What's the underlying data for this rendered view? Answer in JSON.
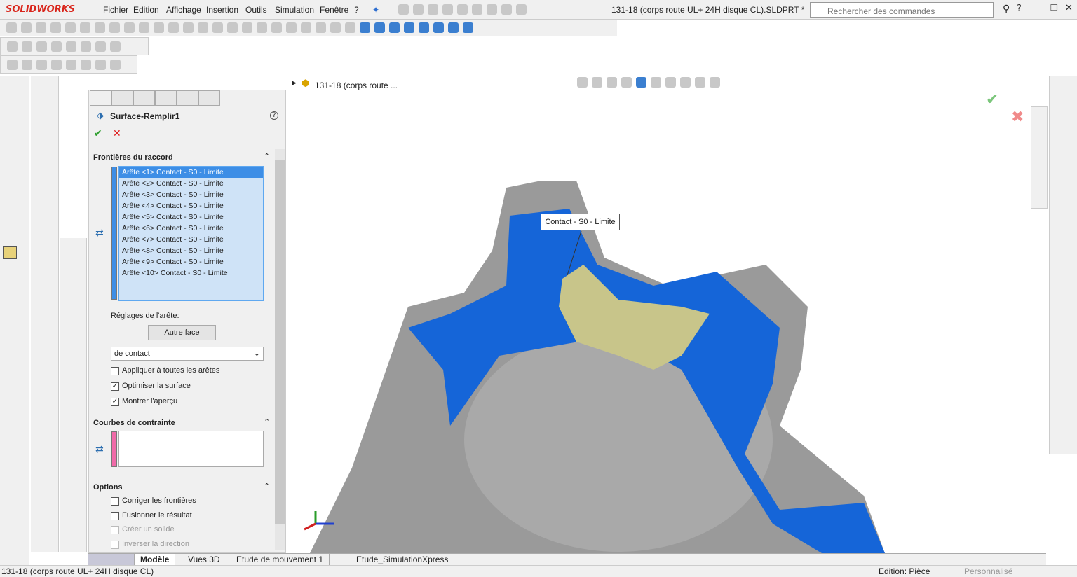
{
  "app": {
    "logo": "SOLIDWORKS",
    "title": "131-18 (corps route UL+ 24H disque CL).SLDPRT *"
  },
  "menu": [
    "Fichier",
    "Edition",
    "Affichage",
    "Insertion",
    "Outils",
    "Simulation",
    "Fenêtre",
    "?"
  ],
  "search": {
    "placeholder": "Rechercher des commandes"
  },
  "viewport": {
    "tree_label": "131-18 (corps route ...",
    "callout": "Contact - S0 - Limite"
  },
  "panel": {
    "feature": "Surface-Remplir1",
    "sections": {
      "boundaries": "Frontières du raccord",
      "constraints": "Courbes de contrainte",
      "options": "Options"
    },
    "edges": [
      "Arête <1> Contact - S0 - Limite",
      "Arête <2> Contact - S0 - Limite",
      "Arête <3> Contact - S0 - Limite",
      "Arête <4> Contact - S0 - Limite",
      "Arête <5> Contact - S0 - Limite",
      "Arête <6> Contact - S0 - Limite",
      "Arête <7> Contact - S0 - Limite",
      "Arête <8> Contact - S0 - Limite",
      "Arête <9> Contact - S0 - Limite",
      "Arête <10> Contact - S0 - Limite"
    ],
    "edge_settings_label": "Réglages de l'arête:",
    "other_face_button": "Autre face",
    "contact_select": "de contact",
    "checks": [
      {
        "label": "Appliquer à toutes les arêtes",
        "checked": false
      },
      {
        "label": "Optimiser la surface",
        "checked": true
      },
      {
        "label": "Montrer l'aperçu",
        "checked": true
      }
    ],
    "options": [
      {
        "label": "Corriger les frontières",
        "checked": false,
        "enabled": true
      },
      {
        "label": "Fusionner le résultat",
        "checked": false,
        "enabled": true
      },
      {
        "label": "Créer un solide",
        "checked": false,
        "enabled": false
      },
      {
        "label": "Inverser la direction",
        "checked": false,
        "enabled": false
      }
    ]
  },
  "bottom_tabs": [
    "Modèle",
    "Vues 3D",
    "Etude de mouvement 1",
    "Etude_SimulationXpress"
  ],
  "status": {
    "file": "131-18 (corps route UL+ 24H disque CL)",
    "mode": "Edition: Pièce",
    "custom": "Personnalisé"
  },
  "colors": {
    "accent": "#1565d8",
    "selection": "#3d8ee6",
    "logo": "#d9261c"
  }
}
